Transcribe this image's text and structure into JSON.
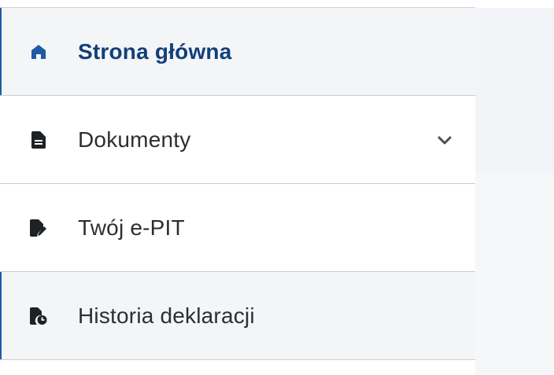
{
  "sidebar": {
    "items": [
      {
        "label": "Strona główna",
        "icon": "home-icon",
        "active": true
      },
      {
        "label": "Dokumenty",
        "icon": "document-icon",
        "expandable": true
      },
      {
        "label": "Twój e-PIT",
        "icon": "document-edit-icon"
      },
      {
        "label": "Historia deklaracji",
        "icon": "document-history-icon"
      }
    ]
  },
  "colors": {
    "accent": "#1f5aa6",
    "active_text": "#123f7c",
    "text": "#2b2f33",
    "divider": "#c9ced4"
  }
}
